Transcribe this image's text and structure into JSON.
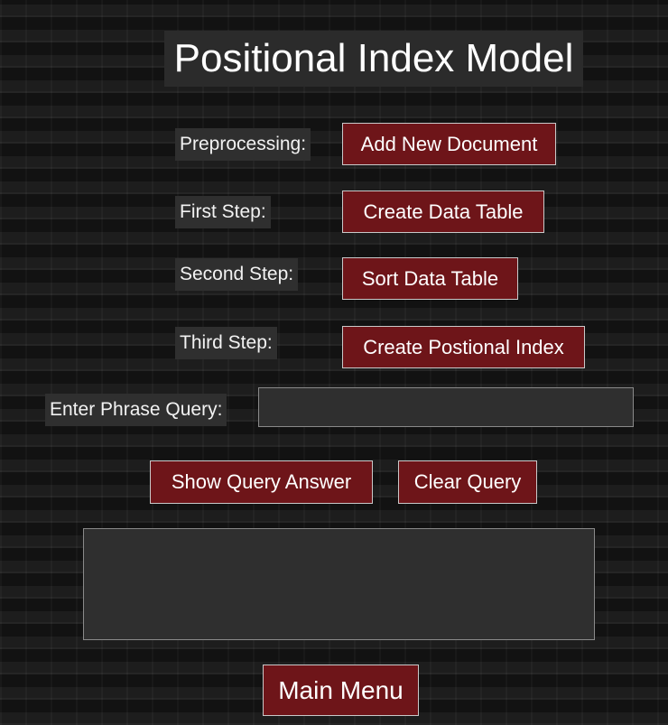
{
  "title": "Positional Index Model",
  "steps": {
    "preprocessing": {
      "label": "Preprocessing:",
      "button": "Add New Document"
    },
    "first": {
      "label": "First Step:",
      "button": "Create Data Table"
    },
    "second": {
      "label": "Second Step:",
      "button": "Sort Data Table"
    },
    "third": {
      "label": "Third Step:",
      "button": "Create Postional Index"
    }
  },
  "query": {
    "label": "Enter Phrase Query:",
    "value": "",
    "show_button": "Show Query Answer",
    "clear_button": "Clear Query",
    "answer": ""
  },
  "main_menu_button": "Main Menu",
  "colors": {
    "button_bg": "#6e1519",
    "label_bg": "#2f2f2f",
    "page_bg": "#151515"
  }
}
